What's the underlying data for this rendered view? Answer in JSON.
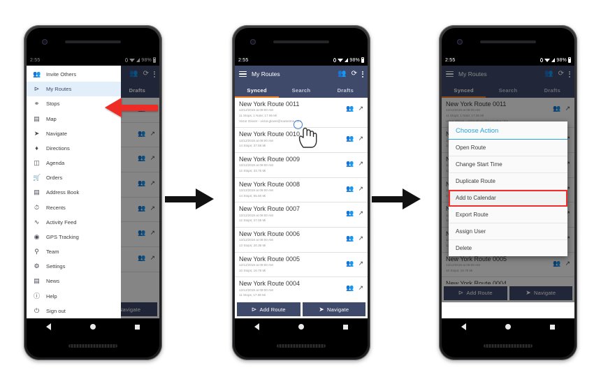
{
  "status_bar": {
    "time": "2:55",
    "battery": "98%",
    "icons": [
      "location-pin-icon",
      "wifi-icon",
      "signal-icon",
      "battery-icon"
    ]
  },
  "app_bar": {
    "title": "My Routes",
    "menu_icon": "hamburger-icon",
    "actions": [
      "add-user-icon",
      "sync-icon",
      "overflow-menu-icon"
    ]
  },
  "tabs": [
    {
      "label": "Synced",
      "active": true
    },
    {
      "label": "Search",
      "active": false
    },
    {
      "label": "Drafts",
      "active": false
    }
  ],
  "bottom_bar": {
    "add_route": "Add Route",
    "navigate": "Navigate",
    "add_route_icon": "route-icon",
    "navigate_icon": "navigation-arrow-icon"
  },
  "nav_bar": {
    "back": "back-triangle-icon",
    "home": "home-circle-icon",
    "recents": "recents-square-icon"
  },
  "drawer": {
    "items": [
      {
        "label": "Invite Others",
        "icon": "add-person-icon",
        "selected": false
      },
      {
        "label": "My Routes",
        "icon": "route-icon",
        "selected": true
      },
      {
        "label": "Stops",
        "icon": "stops-icon",
        "selected": false
      },
      {
        "label": "Map",
        "icon": "map-icon",
        "selected": false
      },
      {
        "label": "Navigate",
        "icon": "navigation-arrow-icon",
        "selected": false
      },
      {
        "label": "Directions",
        "icon": "directions-icon",
        "selected": false
      },
      {
        "label": "Agenda",
        "icon": "agenda-icon",
        "selected": false
      },
      {
        "label": "Orders",
        "icon": "orders-cart-icon",
        "selected": false
      },
      {
        "label": "Address Book",
        "icon": "address-book-icon",
        "selected": false
      },
      {
        "label": "Recents",
        "icon": "clock-icon",
        "selected": false
      },
      {
        "label": "Activity Feed",
        "icon": "activity-pulse-icon",
        "selected": false
      },
      {
        "label": "GPS Tracking",
        "icon": "gps-icon",
        "selected": false
      },
      {
        "label": "Team",
        "icon": "team-icon",
        "selected": false
      },
      {
        "label": "Settings",
        "icon": "settings-icon",
        "selected": false
      },
      {
        "label": "News",
        "icon": "news-icon",
        "selected": false
      },
      {
        "label": "Help",
        "icon": "help-icon",
        "selected": false
      },
      {
        "label": "Sign out",
        "icon": "power-icon",
        "selected": false
      }
    ]
  },
  "routes": [
    {
      "name": "New York Route 0011",
      "datetime": "12/12/2019 at 09:00 AM",
      "stats": "11 Stops; 1 Note; 17.06 Mi",
      "owner": "Victor Glover - victor.glover@route4me.com"
    },
    {
      "name": "New York Route 0010",
      "datetime": "12/12/2019 at 09:00 AM",
      "stats": "14 Stops; 37.68 Mi",
      "owner": ""
    },
    {
      "name": "New York Route 0009",
      "datetime": "12/12/2019 at 09:00 AM",
      "stats": "12 Stops; 33.75 Mi",
      "owner": ""
    },
    {
      "name": "New York Route 0008",
      "datetime": "12/12/2019 at 09:00 AM",
      "stats": "14 Stops; 55.50 Mi",
      "owner": ""
    },
    {
      "name": "New York Route 0007",
      "datetime": "12/12/2019 at 09:00 AM",
      "stats": "12 Stops; 27.05 Mi",
      "owner": ""
    },
    {
      "name": "New York Route 0006",
      "datetime": "12/12/2019 at 09:00 AM",
      "stats": "13 Stops; 20.36 Mi",
      "owner": ""
    },
    {
      "name": "New York Route 0005",
      "datetime": "12/12/2019 at 09:00 AM",
      "stats": "10 Stops; 16.78 Mi",
      "owner": ""
    },
    {
      "name": "New York Route 0004",
      "datetime": "12/12/2019 at 09:00 AM",
      "stats": "11 Stops; 17.06 Mi",
      "owner": ""
    }
  ],
  "row_actions": {
    "assign": "assign-user-icon",
    "share": "share-export-icon"
  },
  "dialog": {
    "title": "Choose Action",
    "items": [
      {
        "label": "Open Route",
        "highlighted": false
      },
      {
        "label": "Change Start Time",
        "highlighted": false
      },
      {
        "label": "Duplicate Route",
        "highlighted": false
      },
      {
        "label": "Add to Calendar",
        "highlighted": true
      },
      {
        "label": "Export Route",
        "highlighted": false
      },
      {
        "label": "Assign User",
        "highlighted": false
      },
      {
        "label": "Delete",
        "highlighted": false
      }
    ]
  },
  "annotations": {
    "red_arrow_target": "My Routes",
    "tap_target": "New York Route 0011",
    "flow_arrow_icon": "right-arrow-icon"
  },
  "colors": {
    "app_bar": "#3f4a6b",
    "tab_indicator": "#f07c1f",
    "dialog_title": "#2aa3dd",
    "highlight_outline": "#ef2d2d",
    "red_arrow": "#ee2b24"
  }
}
